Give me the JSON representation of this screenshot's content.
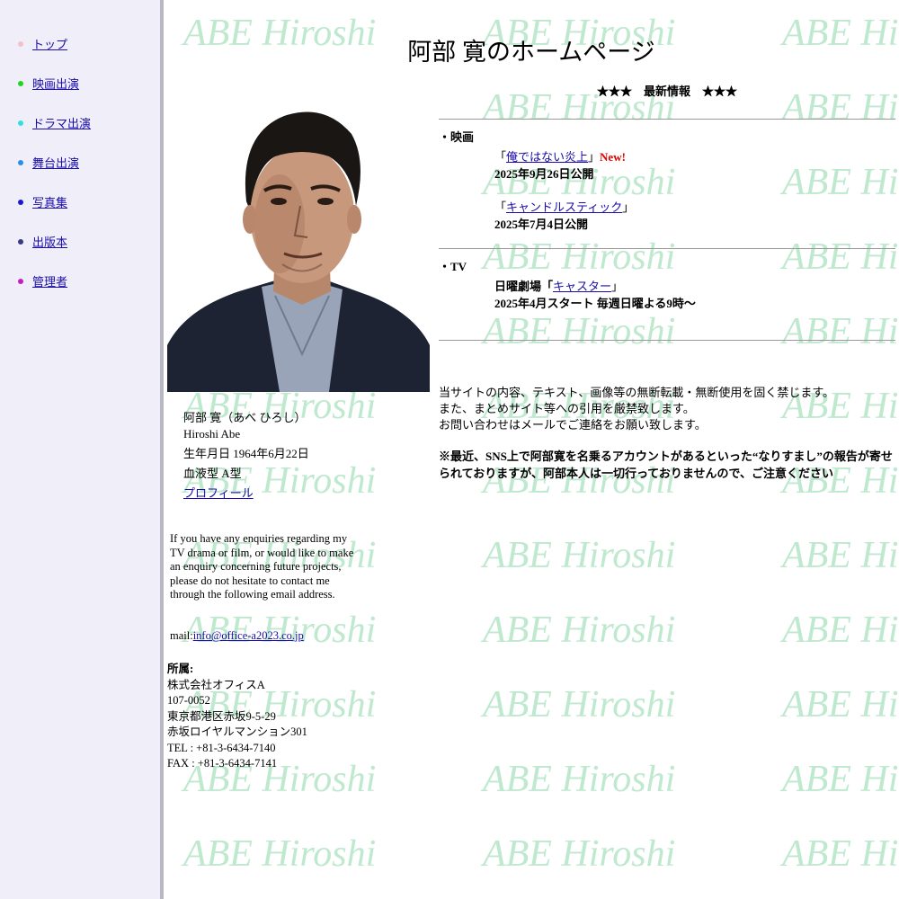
{
  "nav": {
    "items": [
      {
        "label": "トップ",
        "color": "#f5c0c8"
      },
      {
        "label": "映画出演",
        "color": "#22d322"
      },
      {
        "label": "ドラマ出演",
        "color": "#33e0e0"
      },
      {
        "label": "舞台出演",
        "color": "#2a8fe8"
      },
      {
        "label": "写真集",
        "color": "#1a1ad0"
      },
      {
        "label": "出版本",
        "color": "#3a3a80"
      },
      {
        "label": "管理者",
        "color": "#c020c0"
      }
    ]
  },
  "header": {
    "title": "阿部 寛のホームページ"
  },
  "watermark": {
    "text": "ABE Hiroshi",
    "color": "#bfe9cf"
  },
  "profile": {
    "name_ja": "阿部 寛（あべ ひろし）",
    "name_en": "Hiroshi Abe",
    "birthday": "生年月日 1964年6月22日",
    "blood": "血液型 A型",
    "profile_link": "プロフィール"
  },
  "enquiry": {
    "text": "If you have any enquiries regarding my TV drama or film, or would like to make an enquiry concerning future projects, please do not hesitate to contact me through the following email address.",
    "mail_prefix": "mail:",
    "mail": "info@office-a2023.co.jp"
  },
  "company": {
    "label": "所属:",
    "name": "株式会社オフィスA",
    "postal": "107-0052",
    "address1": "東京都港区赤坂9-5-29",
    "address2": "赤坂ロイヤルマンション301",
    "tel": "TEL : +81-3-6434-7140",
    "fax": "FAX : +81-3-6434-7141"
  },
  "news": {
    "heading": "★★★　最新情報　★★★",
    "movie": {
      "label": "・映画",
      "items": [
        {
          "open": "「",
          "title": "俺ではない炎上",
          "close": "」",
          "badge": "New!",
          "date": "2025年9月26日公開"
        },
        {
          "open": "「",
          "title": "キャンドルスティック",
          "close": "」",
          "badge": "",
          "date": "2025年7月4日公開"
        }
      ]
    },
    "tv": {
      "label": "・TV",
      "prefix": "日曜劇場「",
      "title": "キャスター",
      "close": "」",
      "date": "2025年4月スタート 毎週日曜よる9時～"
    }
  },
  "notice": {
    "line1": "当サイトの内容、テキスト、画像等の無断転載・無断使用を固く禁じます。",
    "line2": "また、まとめサイト等への引用を厳禁致します。",
    "line3": "お問い合わせはメールでご連絡をお願い致します。",
    "warning": "※最近、SNS上で阿部寛を名乗るアカウントがあるといった“なりすまし”の報告が寄せられておりますが、阿部本人は一切行っておりませんので、ご注意ください"
  }
}
